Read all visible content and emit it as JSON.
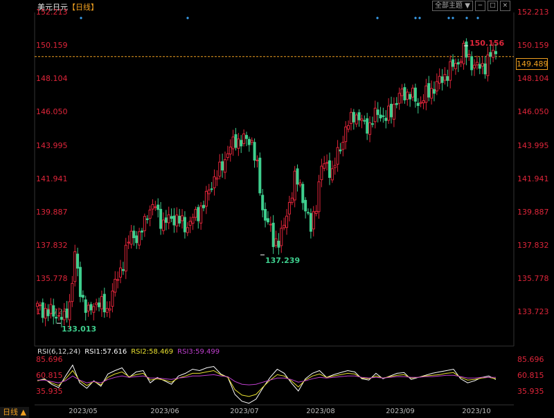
{
  "header": {
    "symbol": "美元日元",
    "period": "【日线】",
    "theme_dropdown": "全部主题",
    "theme_arrow": "▼",
    "buttons": [
      "−",
      "□",
      "×"
    ]
  },
  "footer": {
    "period_button": "日线 ▲"
  },
  "price_axis": {
    "ticks": [
      "152.213",
      "150.159",
      "148.104",
      "146.050",
      "143.995",
      "141.941",
      "139.887",
      "137.832",
      "135.778",
      "133.723"
    ],
    "current": "149.489"
  },
  "rsi_axis": {
    "ticks": [
      "85.696",
      "60.815",
      "35.935"
    ]
  },
  "rsi_legend": {
    "params": "RSI(6,12,24)",
    "rsi1": "RSI1:57.616",
    "rsi2": "RSI2:58.469",
    "rsi3": "RSI3:59.499"
  },
  "annotations": {
    "high": "150.156",
    "low1": "137.239",
    "low2": "133.013"
  },
  "x_labels": [
    "2023/05",
    "2023/06",
    "2023/07",
    "2023/08",
    "2023/09",
    "2023/10"
  ],
  "colors": {
    "up": "#e0253a",
    "down": "#3ecf8e",
    "rsi1": "#ffffff",
    "rsi2": "#e8e030",
    "rsi3": "#c040d0",
    "accent": "#f0a020"
  },
  "chart_data": {
    "type": "candlestick",
    "title": "美元日元",
    "ylim": [
      133.0,
      152.2
    ],
    "y_ticks": [
      152.213,
      150.159,
      148.104,
      146.05,
      143.995,
      141.941,
      139.887,
      137.832,
      135.778,
      133.723
    ],
    "current_price": 149.489,
    "x_tick_labels": [
      "2023/05",
      "2023/06",
      "2023/07",
      "2023/08",
      "2023/09",
      "2023/10"
    ],
    "close_path": [
      [
        0,
        134.0
      ],
      [
        4,
        133.7
      ],
      [
        8,
        133.5
      ],
      [
        10,
        133.2
      ],
      [
        12,
        134.3
      ],
      [
        14,
        137.2
      ],
      [
        16,
        135.0
      ],
      [
        19,
        133.6
      ],
      [
        22,
        134.4
      ],
      [
        26,
        133.8
      ],
      [
        29,
        135.4
      ],
      [
        32,
        136.8
      ],
      [
        35,
        138.6
      ],
      [
        38,
        138.2
      ],
      [
        41,
        139.9
      ],
      [
        44,
        140.2
      ],
      [
        47,
        139.1
      ],
      [
        50,
        139.6
      ],
      [
        53,
        139.3
      ],
      [
        56,
        139.0
      ],
      [
        59,
        139.7
      ],
      [
        62,
        140.3
      ],
      [
        65,
        141.7
      ],
      [
        68,
        142.4
      ],
      [
        71,
        143.6
      ],
      [
        74,
        144.3
      ],
      [
        77,
        144.3
      ],
      [
        80,
        144.3
      ],
      [
        82,
        142.5
      ],
      [
        84,
        140.0
      ],
      [
        86,
        139.3
      ],
      [
        88,
        138.0
      ],
      [
        90,
        138.2
      ],
      [
        92,
        138.9
      ],
      [
        94,
        140.5
      ],
      [
        96,
        141.9
      ],
      [
        98,
        141.5
      ],
      [
        100,
        140.1
      ],
      [
        102,
        138.8
      ],
      [
        104,
        140.5
      ],
      [
        106,
        142.6
      ],
      [
        108,
        142.9
      ],
      [
        110,
        142.2
      ],
      [
        112,
        143.5
      ],
      [
        115,
        144.9
      ],
      [
        118,
        146.0
      ],
      [
        121,
        145.4
      ],
      [
        124,
        145.2
      ],
      [
        127,
        146.1
      ],
      [
        130,
        145.6
      ],
      [
        133,
        146.5
      ],
      [
        136,
        147.2
      ],
      [
        139,
        147.2
      ],
      [
        142,
        146.6
      ],
      [
        145,
        147.1
      ],
      [
        148,
        147.6
      ],
      [
        151,
        148.1
      ],
      [
        154,
        148.7
      ],
      [
        157,
        149.2
      ],
      [
        159,
        149.8
      ],
      [
        161,
        149.4
      ],
      [
        163,
        148.9
      ],
      [
        165,
        148.8
      ],
      [
        167,
        149.0
      ],
      [
        169,
        149.5
      ],
      [
        171,
        149.8
      ]
    ],
    "annotations": [
      {
        "label": "150.156",
        "value": 150.156,
        "type": "high"
      },
      {
        "label": "137.239",
        "value": 137.239,
        "type": "low"
      },
      {
        "label": "133.013",
        "value": 133.013,
        "type": "low"
      }
    ],
    "rsi": {
      "ylim": [
        20,
        100
      ],
      "ticks": [
        85.696,
        60.815,
        35.935
      ],
      "series": [
        {
          "name": "RSI1",
          "last": 57.616,
          "values": [
            55,
            58,
            50,
            45,
            62,
            78,
            52,
            44,
            55,
            47,
            65,
            70,
            74,
            60,
            68,
            70,
            52,
            60,
            55,
            50,
            62,
            66,
            72,
            70,
            74,
            76,
            65,
            60,
            35,
            25,
            22,
            28,
            45,
            60,
            72,
            66,
            52,
            40,
            58,
            66,
            70,
            60,
            64,
            67,
            70,
            68,
            58,
            56,
            66,
            58,
            62,
            66,
            67,
            57,
            60,
            63,
            66,
            68,
            70,
            72,
            58,
            52,
            55,
            60,
            62,
            57
          ]
        },
        {
          "name": "RSI2",
          "last": 58.469,
          "values": [
            55,
            57,
            52,
            48,
            58,
            70,
            55,
            48,
            54,
            49,
            60,
            65,
            68,
            61,
            64,
            66,
            56,
            58,
            56,
            53,
            59,
            62,
            66,
            66,
            68,
            70,
            64,
            60,
            42,
            34,
            32,
            35,
            46,
            56,
            64,
            62,
            55,
            46,
            56,
            62,
            65,
            60,
            62,
            64,
            66,
            65,
            59,
            58,
            62,
            59,
            61,
            63,
            64,
            59,
            60,
            62,
            63,
            64,
            66,
            67,
            60,
            56,
            57,
            59,
            60,
            58
          ]
        },
        {
          "name": "RSI3",
          "last": 59.499,
          "values": [
            56,
            56,
            54,
            52,
            55,
            62,
            56,
            52,
            54,
            52,
            57,
            60,
            62,
            60,
            61,
            62,
            59,
            59,
            58,
            57,
            59,
            60,
            62,
            62,
            63,
            64,
            62,
            61,
            54,
            50,
            49,
            50,
            53,
            56,
            59,
            59,
            57,
            53,
            55,
            58,
            60,
            59,
            60,
            61,
            62,
            62,
            60,
            59,
            60,
            59,
            60,
            61,
            61,
            60,
            60,
            61,
            61,
            62,
            63,
            63,
            61,
            59,
            59,
            60,
            60,
            60
          ]
        }
      ]
    }
  }
}
